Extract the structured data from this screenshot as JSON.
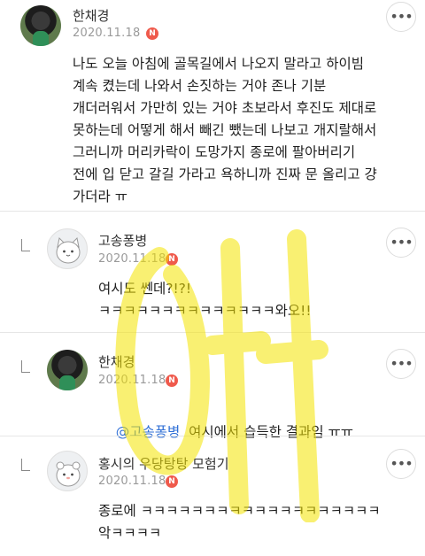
{
  "comments": [
    {
      "name": "한채경",
      "date": "2020.11.18",
      "badge": "N",
      "more": "•••",
      "text": "나도 오늘 아침에 골목길에서 나오지 말라고 하이빔\n계속 켰는데 나와서 손짓하는 거야 존나 기분\n개더러워서 가만히 있는 거야 초보라서 후진도 제대로\n못하는데 어떻게 해서 빼긴 뺐는데 나보고 개지랄해서\n그러니까 머리카락이 도망가지 종로에 팔아버리기\n전에 입 닫고 갈길 가라고 욕하니까 진짜 문 올리고 걍\n가더라 ㅠ"
    },
    {
      "name": "고송퐁병",
      "date": "2020.11.18",
      "badge": "N",
      "more": "•••",
      "text": "여시도 쎈데?!?!\nㅋㅋㅋㅋㅋㅋㅋㅋㅋㅋㅋㅋㅋㅋ와오!!"
    },
    {
      "name": "한채경",
      "date": "2020.11.18",
      "badge": "N",
      "more": "•••",
      "mention": "@고송퐁병",
      "text": "  여시에서 습득한 결과임 ㅠㅠ"
    },
    {
      "name": "홍시의 우당탕탕 모험기",
      "date": "2020.11.18",
      "badge": "N",
      "more": "•••",
      "text": "종로에 ㅋㅋㅋㅋㅋㅋㅋㅋㅋㅋㅋㅋㅋㅋㅋㅋㅋㅋㅋ\n악ㅋㅋㅋㅋ"
    }
  ],
  "colors": {
    "badge": "#ef5a4c",
    "mention": "#2f6fd6",
    "watermark": "#f5e400"
  }
}
